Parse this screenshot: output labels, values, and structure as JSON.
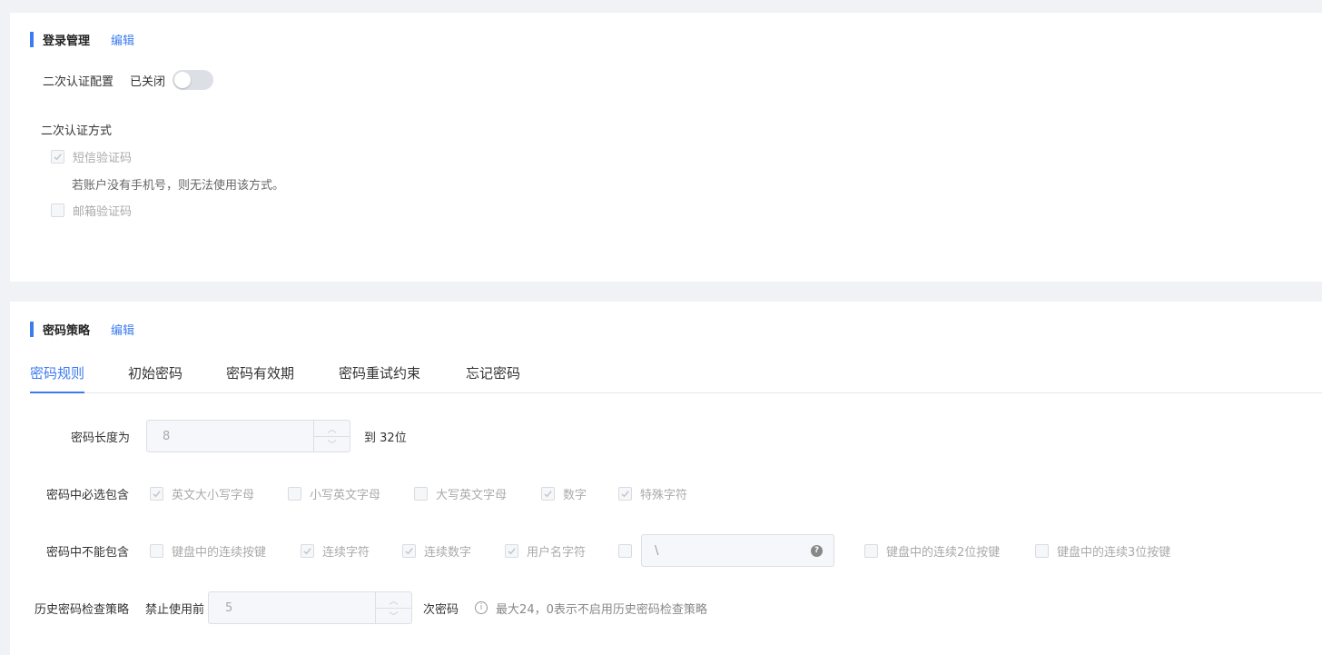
{
  "login_section": {
    "title": "登录管理",
    "edit_label": "编辑",
    "two_factor_label": "二次认证配置",
    "two_factor_status": "已关闭",
    "two_factor_enabled": false,
    "method_title": "二次认证方式",
    "sms_label": "短信验证码",
    "sms_checked": true,
    "sms_hint": "若账户没有手机号，则无法使用该方式。",
    "email_label": "邮箱验证码",
    "email_checked": false
  },
  "password_section": {
    "title": "密码策略",
    "edit_label": "编辑",
    "tabs": [
      {
        "label": "密码规则",
        "active": true
      },
      {
        "label": "初始密码",
        "active": false
      },
      {
        "label": "密码有效期",
        "active": false
      },
      {
        "label": "密码重试约束",
        "active": false
      },
      {
        "label": "忘记密码",
        "active": false
      }
    ],
    "length": {
      "label": "密码长度为",
      "min_value": "8",
      "suffix": "到 32位"
    },
    "must_include": {
      "label": "密码中必选包含",
      "options": [
        {
          "label": "英文大小写字母",
          "checked": true
        },
        {
          "label": "小写英文字母",
          "checked": false
        },
        {
          "label": "大写英文字母",
          "checked": false
        },
        {
          "label": "数字",
          "checked": true
        },
        {
          "label": "特殊字符",
          "checked": true
        }
      ]
    },
    "cannot_include": {
      "label": "密码中不能包含",
      "options": [
        {
          "label": "键盘中的连续按键",
          "checked": false
        },
        {
          "label": "连续字符",
          "checked": true
        },
        {
          "label": "连续数字",
          "checked": true
        },
        {
          "label": "用户名字符",
          "checked": true
        }
      ],
      "custom_checked": false,
      "custom_value": "\\",
      "extra_options": [
        {
          "label": "键盘中的连续2位按键",
          "checked": false
        },
        {
          "label": "键盘中的连续3位按键",
          "checked": false
        }
      ]
    },
    "history": {
      "label": "历史密码检查策略",
      "prefix": "禁止使用前",
      "value": "5",
      "suffix": "次密码",
      "hint": "最大24，0表示不启用历史密码检查策略"
    }
  },
  "icons": {
    "check": "check-icon",
    "question": "question-icon",
    "info": "info-icon",
    "up": "chevron-up-icon",
    "down": "chevron-down-icon"
  },
  "colors": {
    "accent": "#3b7cf0",
    "background": "#f0f2f5"
  }
}
